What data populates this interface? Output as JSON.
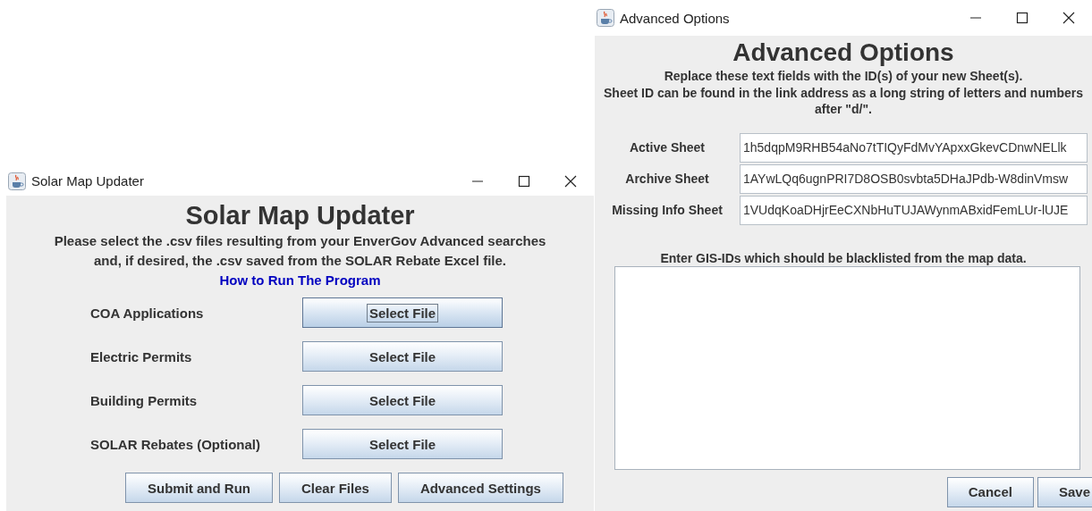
{
  "main_window": {
    "title": "Solar Map Updater",
    "heading": "Solar Map Updater",
    "instructions": [
      "Please select the .csv files resulting from your EnverGov Advanced searches",
      "and, if desired, the .csv saved from the SOLAR Rebate Excel file."
    ],
    "link": "How to Run The Program",
    "file_rows": [
      {
        "label": "COA Applications",
        "button": "Select File",
        "focused": true
      },
      {
        "label": "Electric Permits",
        "button": "Select File",
        "focused": false
      },
      {
        "label": "Building Permits",
        "button": "Select File",
        "focused": false
      },
      {
        "label": "SOLAR Rebates (Optional)",
        "button": "Select File",
        "focused": false
      }
    ],
    "buttons": [
      "Submit and Run",
      "Clear Files",
      "Advanced Settings"
    ]
  },
  "advanced_window": {
    "title": "Advanced Options",
    "heading": "Advanced Options",
    "description": [
      "Replace these text fields with the ID(s) of your new Sheet(s).",
      "Sheet ID can be found in the link address as a long string of letters and numbers",
      "after \"d/\"."
    ],
    "fields": [
      {
        "label": "Active Sheet",
        "value": "1h5dqpM9RHB54aNo7tTIQyFdMvYApxxGkevCDnwNELlk"
      },
      {
        "label": "Archive Sheet",
        "value": "1AYwLQq6ugnPRI7D8OSB0svbta5DHaJPdb-W8dinVmsw"
      },
      {
        "label": "Missing Info Sheet",
        "value": "1VUdqKoaDHjrEeCXNbHuTUJAWynmABxidFemLUr-lUJE"
      }
    ],
    "blacklist_label": "Enter GIS-IDs which should be blacklisted from the map data.",
    "buttons": [
      "Cancel",
      "Save"
    ]
  }
}
